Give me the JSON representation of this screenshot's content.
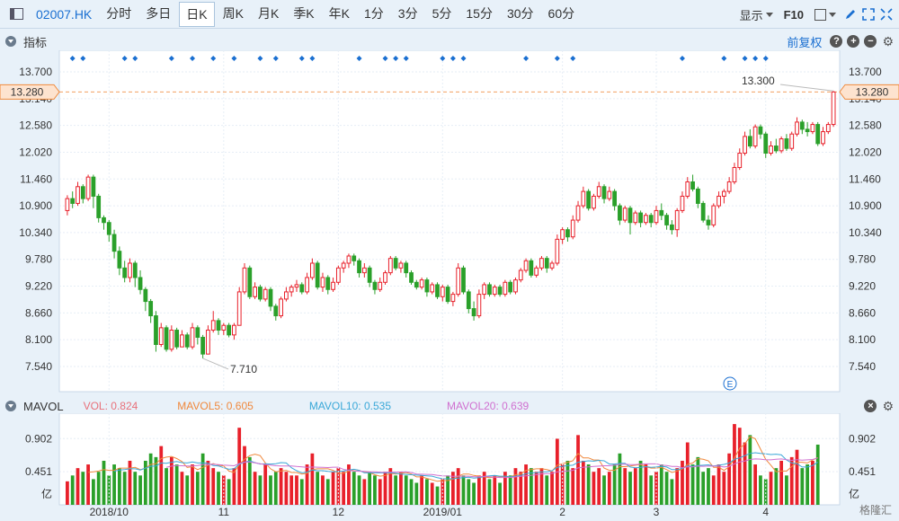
{
  "toolbar": {
    "symbol": "02007.HK",
    "tabs": [
      "分时",
      "多日",
      "日K",
      "周K",
      "月K",
      "季K",
      "年K",
      "1分",
      "3分",
      "5分",
      "15分",
      "30分",
      "60分"
    ],
    "active_tab": "日K",
    "display_label": "显示",
    "f10_label": "F10"
  },
  "indicator_panel": {
    "title": "指标",
    "fuquan_label": "前复权"
  },
  "price": {
    "current_tag": "13.280",
    "high_label": "13.300",
    "low_label": "7.710",
    "event_marker": "E"
  },
  "volume_panel": {
    "title": "MAVOL",
    "vol": {
      "label": "VOL:",
      "value": "0.824",
      "color": "#e8707a"
    },
    "mavol5": {
      "label": "MAVOL5:",
      "value": "0.605",
      "color": "#f0883c"
    },
    "mavol10": {
      "label": "MAVOL10:",
      "value": "0.535",
      "color": "#3aa8d8"
    },
    "mavol20": {
      "label": "MAVOL20:",
      "value": "0.639",
      "color": "#d070d0"
    },
    "unit": "亿"
  },
  "watermark": "格隆汇",
  "colors": {
    "up": "#e8202a",
    "down": "#2aa02a",
    "marker": "#1a6fd1"
  },
  "chart_data": {
    "type": "candlestick",
    "y_ticks": [
      13.7,
      13.14,
      12.58,
      12.02,
      11.46,
      10.9,
      10.34,
      9.78,
      9.22,
      8.66,
      8.1,
      7.54
    ],
    "y_tick_labels": [
      "13.700",
      "13.140",
      "12.580",
      "12.020",
      "11.460",
      "10.900",
      "10.340",
      "9.780",
      "9.220",
      "8.660",
      "8.100",
      "7.540"
    ],
    "x_labels": [
      {
        "label": "2018/10",
        "index": 8
      },
      {
        "label": "11",
        "index": 30
      },
      {
        "label": "12",
        "index": 52
      },
      {
        "label": "2019/01",
        "index": 72
      },
      {
        "label": "2",
        "index": 95
      },
      {
        "label": "3",
        "index": 113
      },
      {
        "label": "4",
        "index": 134
      }
    ],
    "candles": [
      [
        10.8,
        11.05,
        11.12,
        10.7
      ],
      [
        11.05,
        10.95,
        11.2,
        10.85
      ],
      [
        10.95,
        11.3,
        11.4,
        10.9
      ],
      [
        11.3,
        11.05,
        11.35,
        10.95
      ],
      [
        11.05,
        11.5,
        11.55,
        11.0
      ],
      [
        11.5,
        11.1,
        11.55,
        10.85
      ],
      [
        11.1,
        10.65,
        11.15,
        10.55
      ],
      [
        10.65,
        10.55,
        10.7,
        10.4
      ],
      [
        10.55,
        10.3,
        10.6,
        10.15
      ],
      [
        10.3,
        9.95,
        10.4,
        9.8
      ],
      [
        9.95,
        9.6,
        10.05,
        9.45
      ],
      [
        9.6,
        9.4,
        9.75,
        9.3
      ],
      [
        9.4,
        9.7,
        9.8,
        9.3
      ],
      [
        9.7,
        9.4,
        9.75,
        9.2
      ],
      [
        9.4,
        9.15,
        9.55,
        9.05
      ],
      [
        9.15,
        8.9,
        9.2,
        8.7
      ],
      [
        8.9,
        8.6,
        8.95,
        8.45
      ],
      [
        8.6,
        8.0,
        8.7,
        7.85
      ],
      [
        8.0,
        8.35,
        8.45,
        7.95
      ],
      [
        8.35,
        7.9,
        8.4,
        7.85
      ],
      [
        7.9,
        8.3,
        8.4,
        7.85
      ],
      [
        8.3,
        7.95,
        8.35,
        7.9
      ],
      [
        7.95,
        8.2,
        8.3,
        7.95
      ],
      [
        8.2,
        7.95,
        8.25,
        7.9
      ],
      [
        7.95,
        8.35,
        8.45,
        7.9
      ],
      [
        8.35,
        8.15,
        8.4,
        8.0
      ],
      [
        8.15,
        7.8,
        8.2,
        7.71
      ],
      [
        7.8,
        8.3,
        8.4,
        7.8
      ],
      [
        8.3,
        8.5,
        8.7,
        8.25
      ],
      [
        8.5,
        8.3,
        8.55,
        8.2
      ],
      [
        8.3,
        8.4,
        8.45,
        8.2
      ],
      [
        8.4,
        8.2,
        8.45,
        8.15
      ],
      [
        8.2,
        8.4,
        8.45,
        8.1
      ],
      [
        8.4,
        9.1,
        9.2,
        8.4
      ],
      [
        9.1,
        9.6,
        9.7,
        9.05
      ],
      [
        9.6,
        9.0,
        9.65,
        8.95
      ],
      [
        9.0,
        9.2,
        9.3,
        8.95
      ],
      [
        9.2,
        8.95,
        9.25,
        8.9
      ],
      [
        8.95,
        9.15,
        9.2,
        8.9
      ],
      [
        9.15,
        8.8,
        9.2,
        8.7
      ],
      [
        8.8,
        8.6,
        8.85,
        8.5
      ],
      [
        8.6,
        8.95,
        9.0,
        8.55
      ],
      [
        8.95,
        9.1,
        9.2,
        8.9
      ],
      [
        9.1,
        9.2,
        9.25,
        9.0
      ],
      [
        9.2,
        9.25,
        9.35,
        9.1
      ],
      [
        9.25,
        9.1,
        9.3,
        9.05
      ],
      [
        9.1,
        9.4,
        9.5,
        9.05
      ],
      [
        9.4,
        9.7,
        9.8,
        9.35
      ],
      [
        9.7,
        9.2,
        9.75,
        9.15
      ],
      [
        9.2,
        9.4,
        9.5,
        9.1
      ],
      [
        9.4,
        9.15,
        9.45,
        9.05
      ],
      [
        9.15,
        9.3,
        9.4,
        9.1
      ],
      [
        9.3,
        9.6,
        9.65,
        9.25
      ],
      [
        9.6,
        9.7,
        9.75,
        9.5
      ],
      [
        9.7,
        9.85,
        9.9,
        9.6
      ],
      [
        9.85,
        9.75,
        9.9,
        9.65
      ],
      [
        9.75,
        9.5,
        9.8,
        9.4
      ],
      [
        9.5,
        9.6,
        9.7,
        9.4
      ],
      [
        9.6,
        9.3,
        9.65,
        9.2
      ],
      [
        9.3,
        9.15,
        9.35,
        9.05
      ],
      [
        9.15,
        9.3,
        9.4,
        9.1
      ],
      [
        9.3,
        9.5,
        9.55,
        9.25
      ],
      [
        9.5,
        9.8,
        9.85,
        9.45
      ],
      [
        9.8,
        9.6,
        9.85,
        9.55
      ],
      [
        9.6,
        9.7,
        9.75,
        9.5
      ],
      [
        9.7,
        9.5,
        9.75,
        9.4
      ],
      [
        9.5,
        9.3,
        9.55,
        9.25
      ],
      [
        9.3,
        9.2,
        9.35,
        9.15
      ],
      [
        9.2,
        9.35,
        9.4,
        9.15
      ],
      [
        9.35,
        9.1,
        9.4,
        9.0
      ],
      [
        9.1,
        9.25,
        9.3,
        9.05
      ],
      [
        9.25,
        9.0,
        9.3,
        8.95
      ],
      [
        9.0,
        9.2,
        9.25,
        8.9
      ],
      [
        9.2,
        8.9,
        9.25,
        8.85
      ],
      [
        8.9,
        9.05,
        9.1,
        8.8
      ],
      [
        9.05,
        9.6,
        9.7,
        9.0
      ],
      [
        9.6,
        9.1,
        9.65,
        9.05
      ],
      [
        9.1,
        8.75,
        9.15,
        8.65
      ],
      [
        8.75,
        8.6,
        8.9,
        8.5
      ],
      [
        8.6,
        9.05,
        9.15,
        8.55
      ],
      [
        9.05,
        9.25,
        9.3,
        8.95
      ],
      [
        9.25,
        9.05,
        9.3,
        9.0
      ],
      [
        9.05,
        9.2,
        9.25,
        9.0
      ],
      [
        9.2,
        9.05,
        9.25,
        9.0
      ],
      [
        9.05,
        9.3,
        9.35,
        9.0
      ],
      [
        9.3,
        9.1,
        9.35,
        9.05
      ],
      [
        9.1,
        9.35,
        9.4,
        9.05
      ],
      [
        9.35,
        9.55,
        9.6,
        9.3
      ],
      [
        9.55,
        9.75,
        9.8,
        9.5
      ],
      [
        9.75,
        9.45,
        9.8,
        9.4
      ],
      [
        9.45,
        9.6,
        9.65,
        9.4
      ],
      [
        9.6,
        9.8,
        9.85,
        9.55
      ],
      [
        9.8,
        9.6,
        9.85,
        9.5
      ],
      [
        9.6,
        9.7,
        9.75,
        9.55
      ],
      [
        9.7,
        10.2,
        10.3,
        9.65
      ],
      [
        10.2,
        10.4,
        10.45,
        10.1
      ],
      [
        10.4,
        10.25,
        10.45,
        10.15
      ],
      [
        10.25,
        10.6,
        10.7,
        10.2
      ],
      [
        10.6,
        10.9,
        11.0,
        10.55
      ],
      [
        10.9,
        11.2,
        11.3,
        10.85
      ],
      [
        11.2,
        10.85,
        11.25,
        10.8
      ],
      [
        10.85,
        11.1,
        11.15,
        10.8
      ],
      [
        11.1,
        11.3,
        11.4,
        11.05
      ],
      [
        11.3,
        11.05,
        11.35,
        10.95
      ],
      [
        11.05,
        11.2,
        11.3,
        11.0
      ],
      [
        11.2,
        10.9,
        11.25,
        10.8
      ],
      [
        10.9,
        10.6,
        10.95,
        10.5
      ],
      [
        10.6,
        10.85,
        10.9,
        10.55
      ],
      [
        10.85,
        10.55,
        10.9,
        10.3
      ],
      [
        10.55,
        10.75,
        10.8,
        10.5
      ],
      [
        10.75,
        10.55,
        10.8,
        10.45
      ],
      [
        10.55,
        10.7,
        10.75,
        10.5
      ],
      [
        10.7,
        10.55,
        10.75,
        10.45
      ],
      [
        10.55,
        10.8,
        10.9,
        10.5
      ],
      [
        10.8,
        10.7,
        10.95,
        10.6
      ],
      [
        10.7,
        10.5,
        10.75,
        10.4
      ],
      [
        10.5,
        10.4,
        10.6,
        10.3
      ],
      [
        10.4,
        10.8,
        10.85,
        10.25
      ],
      [
        10.8,
        11.1,
        11.2,
        10.75
      ],
      [
        11.1,
        11.4,
        11.5,
        11.05
      ],
      [
        11.4,
        11.25,
        11.55,
        11.2
      ],
      [
        11.25,
        10.95,
        11.3,
        10.85
      ],
      [
        10.95,
        10.6,
        11.0,
        10.55
      ],
      [
        10.6,
        10.5,
        10.7,
        10.4
      ],
      [
        10.5,
        10.9,
        10.95,
        10.45
      ],
      [
        10.9,
        11.1,
        11.2,
        10.85
      ],
      [
        11.1,
        11.2,
        11.25,
        10.95
      ],
      [
        11.2,
        11.4,
        11.5,
        11.15
      ],
      [
        11.4,
        11.7,
        11.8,
        11.35
      ],
      [
        11.7,
        12.0,
        12.1,
        11.65
      ],
      [
        12.0,
        12.35,
        12.45,
        11.95
      ],
      [
        12.35,
        12.15,
        12.5,
        12.1
      ],
      [
        12.15,
        12.55,
        12.6,
        12.1
      ],
      [
        12.55,
        12.4,
        12.6,
        12.3
      ],
      [
        12.4,
        12.0,
        12.45,
        11.9
      ],
      [
        12.0,
        12.15,
        12.25,
        11.95
      ],
      [
        12.15,
        12.05,
        12.3,
        12.0
      ],
      [
        12.05,
        12.3,
        12.35,
        12.0
      ],
      [
        12.3,
        12.1,
        12.4,
        12.05
      ],
      [
        12.1,
        12.4,
        12.45,
        12.05
      ],
      [
        12.4,
        12.65,
        12.75,
        12.35
      ],
      [
        12.65,
        12.5,
        12.7,
        12.4
      ],
      [
        12.5,
        12.45,
        12.65,
        12.35
      ],
      [
        12.45,
        12.6,
        12.65,
        12.4
      ],
      [
        12.6,
        12.2,
        12.65,
        12.15
      ],
      [
        12.2,
        12.45,
        12.55,
        12.15
      ],
      [
        12.45,
        12.6,
        12.65,
        12.4
      ],
      [
        12.6,
        13.28,
        13.3,
        12.55
      ]
    ],
    "volumes": [
      0.32,
      0.4,
      0.5,
      0.45,
      0.55,
      0.35,
      0.45,
      0.6,
      0.4,
      0.55,
      0.5,
      0.45,
      0.6,
      0.45,
      0.4,
      0.6,
      0.7,
      0.65,
      0.8,
      0.5,
      0.65,
      0.55,
      0.45,
      0.4,
      0.55,
      0.45,
      0.7,
      0.6,
      0.5,
      0.45,
      0.4,
      0.35,
      0.5,
      1.05,
      0.8,
      0.65,
      0.45,
      0.4,
      0.55,
      0.4,
      0.45,
      0.5,
      0.45,
      0.4,
      0.4,
      0.35,
      0.55,
      0.7,
      0.45,
      0.4,
      0.35,
      0.45,
      0.5,
      0.45,
      0.55,
      0.45,
      0.4,
      0.35,
      0.45,
      0.4,
      0.35,
      0.45,
      0.5,
      0.4,
      0.45,
      0.4,
      0.35,
      0.3,
      0.4,
      0.35,
      0.3,
      0.25,
      0.35,
      0.4,
      0.45,
      0.5,
      0.4,
      0.35,
      0.3,
      0.4,
      0.45,
      0.35,
      0.4,
      0.3,
      0.45,
      0.4,
      0.5,
      0.45,
      0.55,
      0.5,
      0.45,
      0.5,
      0.4,
      0.45,
      0.9,
      0.55,
      0.6,
      0.5,
      0.95,
      0.6,
      0.55,
      0.45,
      0.5,
      0.4,
      0.45,
      0.55,
      0.7,
      0.5,
      0.45,
      0.5,
      0.6,
      0.55,
      0.4,
      0.45,
      0.55,
      0.45,
      0.35,
      0.5,
      0.6,
      0.85,
      0.55,
      0.65,
      0.45,
      0.5,
      0.4,
      0.55,
      0.45,
      0.7,
      1.1,
      1.05,
      0.85,
      0.95,
      0.55,
      0.4,
      0.35,
      0.45,
      0.5,
      0.6,
      0.4,
      0.65,
      0.75,
      0.5,
      0.55,
      0.6,
      0.82
    ],
    "vol_axis": {
      "ticks": [
        0.902,
        0.451
      ],
      "labels": [
        "0.902",
        "0.451"
      ]
    }
  }
}
